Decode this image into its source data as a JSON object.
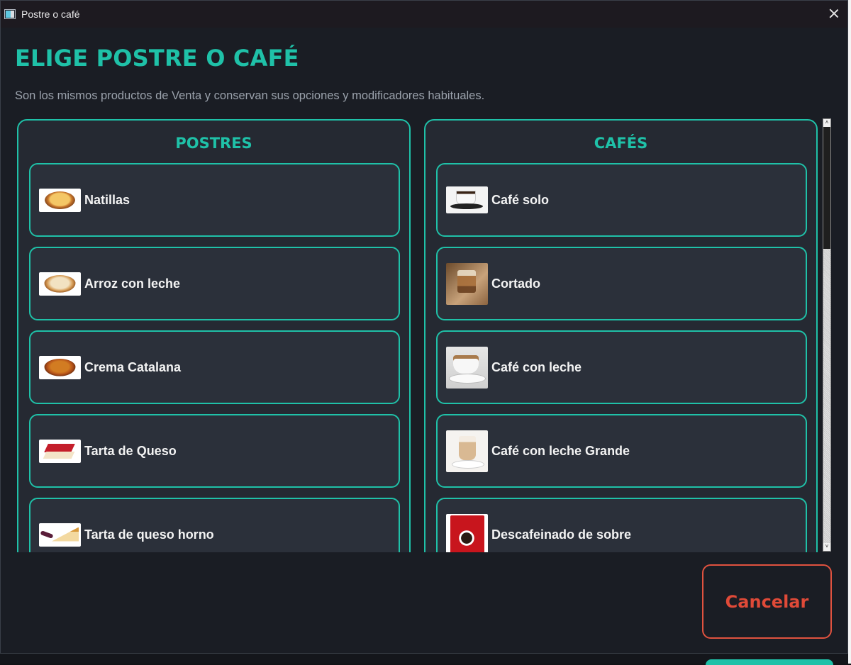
{
  "window": {
    "title": "Postre o café"
  },
  "header": {
    "heading": "ELIGE POSTRE O CAFÉ",
    "subtitle": "Son los mismos productos de Venta y conservan sus opciones y modificadores habituales."
  },
  "postres": {
    "title": "POSTRES",
    "items": [
      {
        "label": "Natillas",
        "image": "natillas"
      },
      {
        "label": "Arroz con leche",
        "image": "arroz-con-leche"
      },
      {
        "label": "Crema Catalana",
        "image": "crema-catalana"
      },
      {
        "label": "Tarta de Queso",
        "image": "tarta-de-queso"
      },
      {
        "label": "Tarta de queso horno",
        "image": "tarta-de-queso-horno"
      }
    ]
  },
  "cafes": {
    "title": "CAFÉS",
    "items": [
      {
        "label": "Café solo",
        "image": "cafe-solo"
      },
      {
        "label": "Cortado",
        "image": "cortado"
      },
      {
        "label": "Café con leche",
        "image": "cafe-con-leche"
      },
      {
        "label": "Café con leche Grande",
        "image": "cafe-con-leche-grande"
      },
      {
        "label": "Descafeinado de sobre",
        "image": "descafeinado-de-sobre"
      }
    ]
  },
  "actions": {
    "cancel_label": "Cancelar"
  },
  "colors": {
    "accent": "#1fc1a8",
    "cancel": "#e04a38",
    "background": "#1a1d24",
    "card": "#2b303a"
  }
}
